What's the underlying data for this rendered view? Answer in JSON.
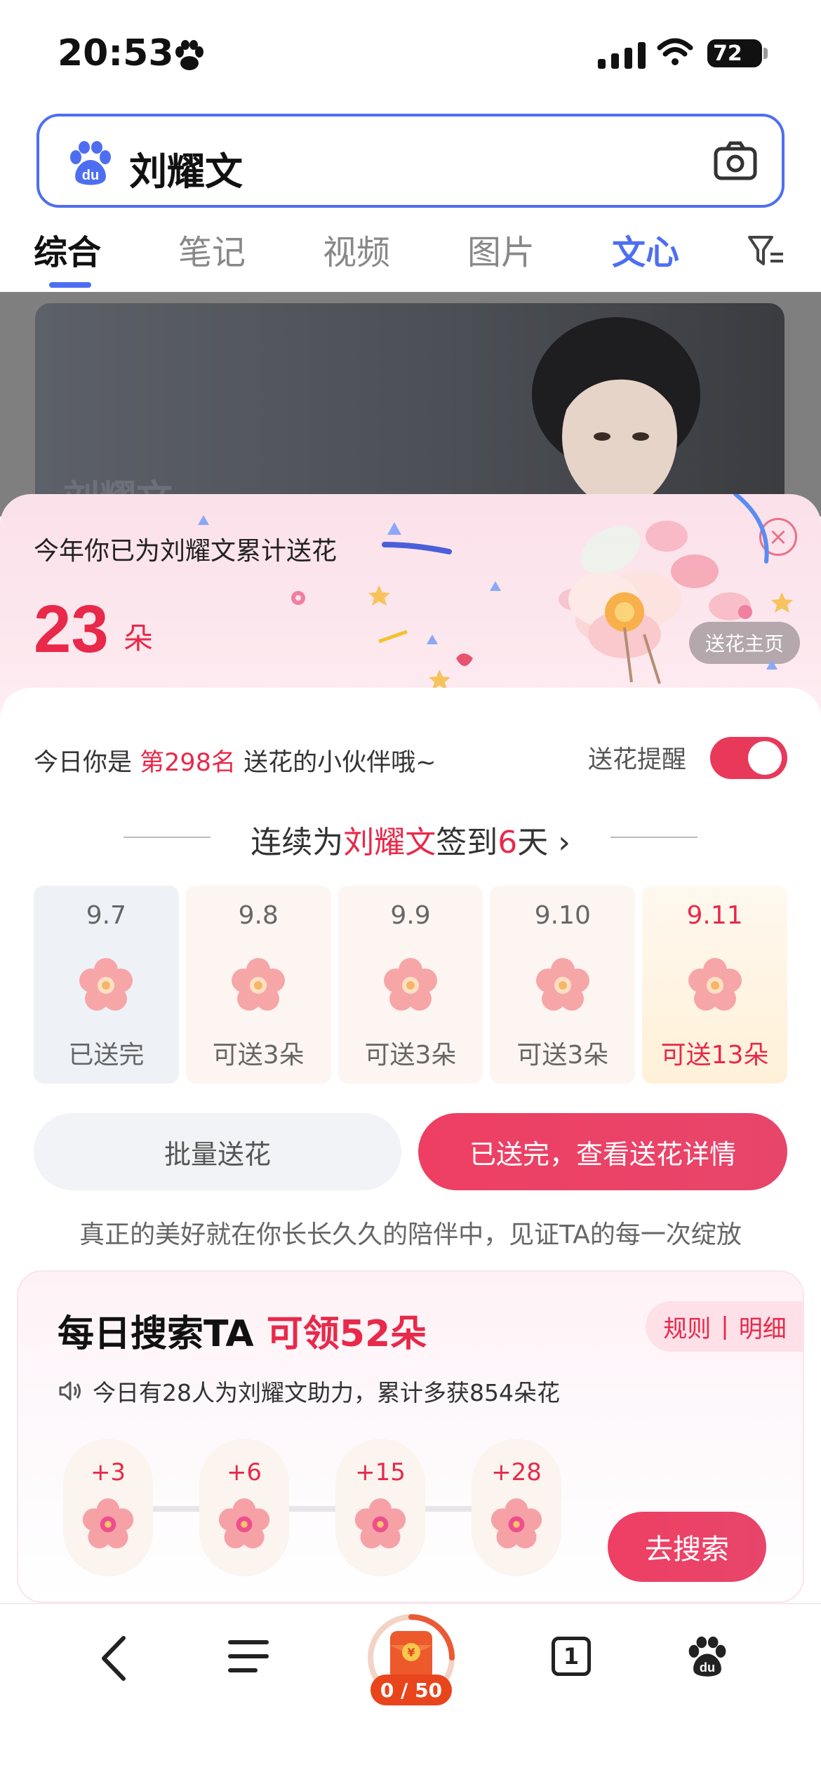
{
  "status_bar": {
    "time": "20:53",
    "battery": "72"
  },
  "search": {
    "query": "刘耀文"
  },
  "tabs": [
    {
      "label": "综合"
    },
    {
      "label": "笔记"
    },
    {
      "label": "视频"
    },
    {
      "label": "图片"
    },
    {
      "label": "文心"
    }
  ],
  "banner": {
    "ghost_name": "刘耀文"
  },
  "summary": {
    "label": "今年你已为刘耀文累计送花",
    "count": "23",
    "unit": "朵",
    "home_link": "送花主页",
    "close": "×"
  },
  "rank": {
    "prefix": "今日你是",
    "rank": "第298名",
    "suffix": "送花的小伙伴哦~",
    "remind_label": "送花提醒",
    "remind_on": true
  },
  "streak": {
    "prefix": "连续为",
    "name": "刘耀文",
    "middle": "签到",
    "days": "6",
    "suffix": "天 ›"
  },
  "days": [
    {
      "date": "9.7",
      "status": "已送完",
      "state": "done"
    },
    {
      "date": "9.8",
      "status": "可送3朵",
      "state": "available"
    },
    {
      "date": "9.9",
      "status": "可送3朵",
      "state": "available"
    },
    {
      "date": "9.10",
      "status": "可送3朵",
      "state": "available"
    },
    {
      "date": "9.11",
      "status": "可送13朵",
      "state": "today"
    }
  ],
  "buttons": {
    "batch": "批量送花",
    "detail": "已送完，查看送花详情"
  },
  "slogan": "真正的美好就在你长长久久的陪伴中，见证TA的每一次绽放",
  "daily": {
    "title": "每日搜索TA",
    "reward_text": "可领52朵",
    "rule": "规则",
    "detail": "明细",
    "helper": "今日有28人为刘耀文助力，累计多获854朵花",
    "rewards": [
      "+3",
      "+6",
      "+15",
      "+28"
    ],
    "cta": "去搜索"
  },
  "bottom_nav": {
    "redpacket_count": "0 / 50",
    "tab_count": "1"
  },
  "colors": {
    "accent_blue": "#4e6ef2",
    "accent_red": "#e8294a",
    "pink_button": "#ee3f63"
  }
}
